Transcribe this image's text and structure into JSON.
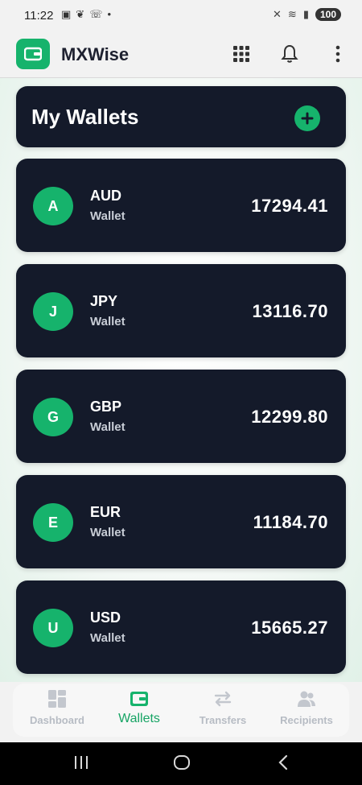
{
  "status_bar": {
    "time": "11:22",
    "battery": "100"
  },
  "app": {
    "title": "MXWise",
    "accent": "#16b36c"
  },
  "header": {
    "title": "My Wallets"
  },
  "wallets": [
    {
      "initial": "A",
      "currency": "AUD",
      "subtitle": "Wallet",
      "amount": "17294.41"
    },
    {
      "initial": "J",
      "currency": "JPY",
      "subtitle": "Wallet",
      "amount": "13116.70"
    },
    {
      "initial": "G",
      "currency": "GBP",
      "subtitle": "Wallet",
      "amount": "12299.80"
    },
    {
      "initial": "E",
      "currency": "EUR",
      "subtitle": "Wallet",
      "amount": "11184.70"
    },
    {
      "initial": "U",
      "currency": "USD",
      "subtitle": "Wallet",
      "amount": "15665.27"
    }
  ],
  "bottom_nav": {
    "items": [
      {
        "label": "Dashboard",
        "icon": "dashboard-icon"
      },
      {
        "label": "Wallets",
        "icon": "wallet-icon",
        "active": true
      },
      {
        "label": "Transfers",
        "icon": "transfer-icon"
      },
      {
        "label": "Recipients",
        "icon": "recipients-icon"
      }
    ]
  }
}
